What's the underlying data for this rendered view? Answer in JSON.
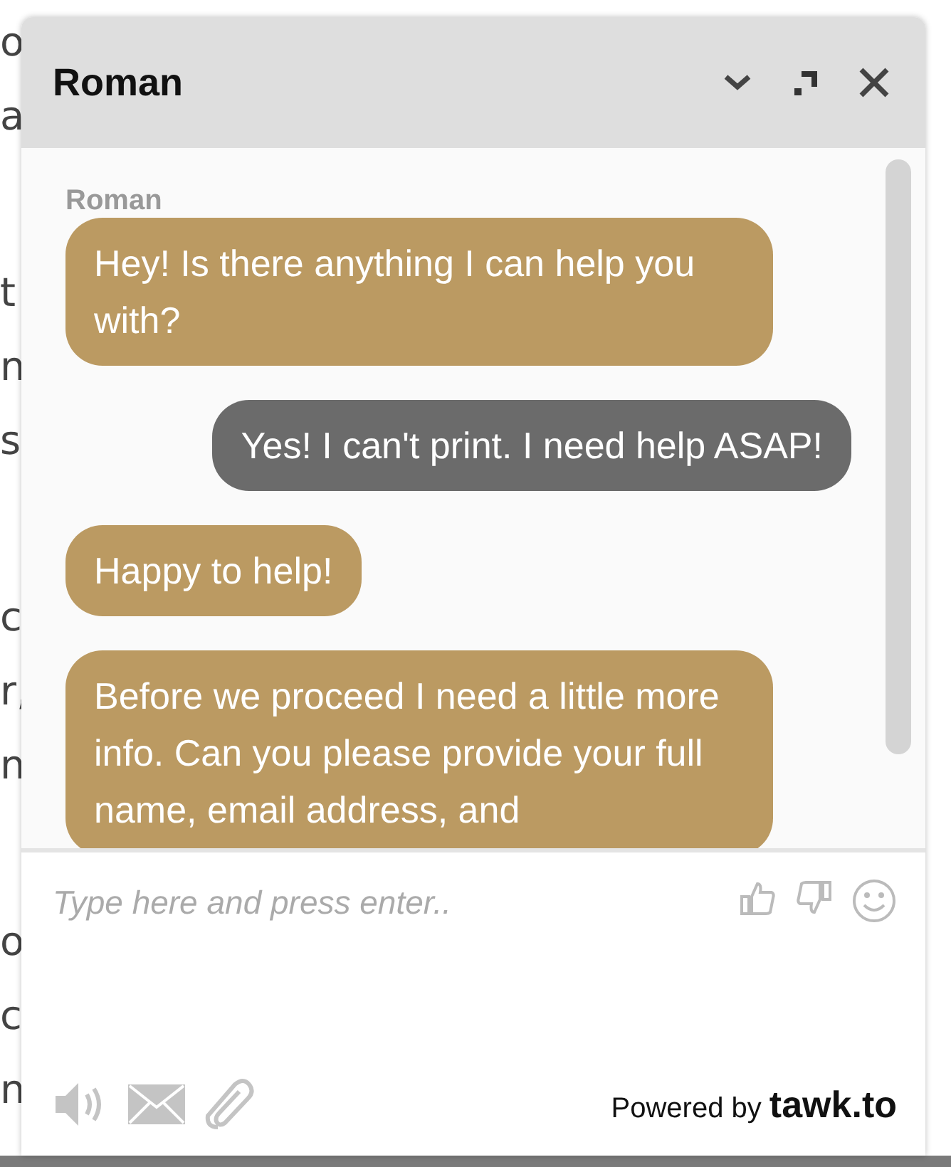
{
  "background_page": {
    "paragraphs": [
      [
        "o",
        "a"
      ],
      [
        "t",
        "n",
        "s"
      ],
      [
        "c",
        "r,",
        "n"
      ],
      [
        "o",
        "c",
        "n"
      ]
    ]
  },
  "chat": {
    "title": "Roman",
    "messages": [
      {
        "kind": "name",
        "text": "Roman"
      },
      {
        "kind": "agent",
        "text": "Hey! Is there anything I can help you with?"
      },
      {
        "kind": "visitor",
        "text": "Yes! I can't print. I need help ASAP!"
      },
      {
        "kind": "agent",
        "text": "Happy to help!"
      },
      {
        "kind": "agent",
        "text": "Before we proceed I need a little more info. Can you please provide your full name, email address, and"
      }
    ],
    "input": {
      "placeholder": "Type here and press enter.."
    },
    "powered_by": "Powered by **tawk.to**"
  }
}
